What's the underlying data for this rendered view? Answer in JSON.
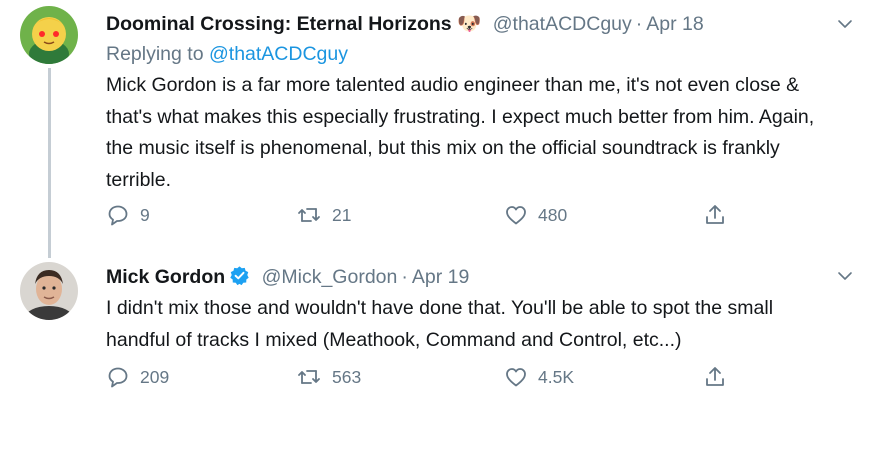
{
  "tweets": [
    {
      "author_name": "Doominal Crossing: Eternal Horizons",
      "author_emoji": "🐶",
      "handle": "@thatACDCguy",
      "separator": "·",
      "date": "Apr 18",
      "replying_to_prefix": "Replying to",
      "replying_to_handle": "@thatACDCguy",
      "text": "Mick Gordon is a far more talented audio engineer than me, it's not even close & that's what makes this especially frustrating. I expect much better from him. Again, the music itself is phenomenal, but this mix on the official soundtrack is frankly terrible.",
      "replies": "9",
      "retweets": "21",
      "likes": "480"
    },
    {
      "author_name": "Mick Gordon",
      "verified": true,
      "handle": "@Mick_Gordon",
      "separator": "·",
      "date": "Apr 19",
      "text": "I didn't mix those and wouldn't have done that.  You'll be able to spot the small handful of tracks I mixed (Meathook, Command and Control, etc...)",
      "replies": "209",
      "retweets": "563",
      "likes": "4.5K"
    }
  ],
  "colors": {
    "text": "#14171a",
    "secondary": "#657786",
    "link": "#1b95e0",
    "verified": "#1da1f2",
    "thread_line": "#c5cdd4"
  },
  "icons": [
    "reply-icon",
    "retweet-icon",
    "like-icon",
    "share-icon",
    "chevron-down-icon",
    "verified-badge-icon"
  ]
}
